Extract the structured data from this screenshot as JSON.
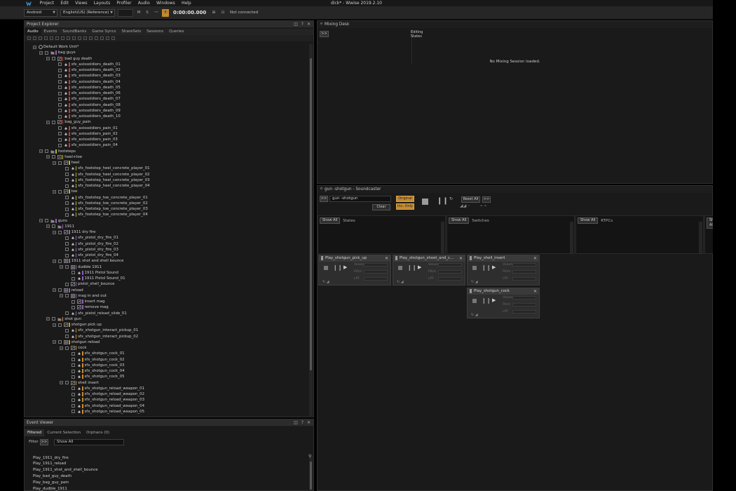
{
  "window": {
    "title": "dick* - Wwise 2019.2.10",
    "menus": [
      "Project",
      "Edit",
      "Views",
      "Layouts",
      "Profiler",
      "Audio",
      "Windows",
      "Help"
    ]
  },
  "toolbar": {
    "platform": "Android",
    "language": "English(US) (Reference)",
    "mute": "M",
    "solo": "S",
    "time": "0:00:00.000",
    "status": "Not connected"
  },
  "project_explorer": {
    "title": "Project Explorer",
    "tabs": [
      "Audio",
      "Events",
      "SoundBanks",
      "Game Syncs",
      "ShareSets",
      "Sessions",
      "Queries"
    ],
    "active_tab": "Audio",
    "tree": [
      {
        "d": 0,
        "t": "wu",
        "label": "Default Work Unit*"
      },
      {
        "d": 1,
        "t": "folder",
        "label": "bag guys",
        "c": "#8f5db7"
      },
      {
        "d": 2,
        "t": "random",
        "label": "bad guy death",
        "c": "#c03a3a"
      },
      {
        "d": 3,
        "t": "sfx",
        "label": "sfx_axissoldiers_death_01",
        "c": "#c03a3a"
      },
      {
        "d": 3,
        "t": "sfx",
        "label": "sfx_axissoldiers_death_02",
        "c": "#c03a3a"
      },
      {
        "d": 3,
        "t": "sfx",
        "label": "sfx_axissoldiers_death_03",
        "c": "#c03a3a"
      },
      {
        "d": 3,
        "t": "sfx",
        "label": "sfx_axissoldiers_death_04",
        "c": "#c03a3a"
      },
      {
        "d": 3,
        "t": "sfx",
        "label": "sfx_axissoldiers_death_05",
        "c": "#c03a3a"
      },
      {
        "d": 3,
        "t": "sfx",
        "label": "sfx_axissoldiers_death_06",
        "c": "#c03a3a"
      },
      {
        "d": 3,
        "t": "sfx",
        "label": "sfx_axissoldiers_death_07",
        "c": "#c03a3a"
      },
      {
        "d": 3,
        "t": "sfx",
        "label": "sfx_axissoldiers_death_08",
        "c": "#c03a3a"
      },
      {
        "d": 3,
        "t": "sfx",
        "label": "sfx_axissoldiers_death_09",
        "c": "#c03a3a"
      },
      {
        "d": 3,
        "t": "sfx",
        "label": "sfx_axissoldiers_death_10",
        "c": "#c03a3a"
      },
      {
        "d": 2,
        "t": "random",
        "label": "bag_guy_pain",
        "c": "#c03a3a"
      },
      {
        "d": 3,
        "t": "sfx",
        "label": "sfx_axissoldiers_pain_01",
        "c": "#c03a3a"
      },
      {
        "d": 3,
        "t": "sfx",
        "label": "sfx_axissoldiers_pain_02",
        "c": "#c03a3a"
      },
      {
        "d": 3,
        "t": "sfx",
        "label": "sfx_axissoldiers_pain_03",
        "c": "#c03a3a"
      },
      {
        "d": 3,
        "t": "sfx",
        "label": "sfx_axissoldiers_pain_04",
        "c": "#c03a3a"
      },
      {
        "d": 1,
        "t": "folder",
        "label": "footsteps",
        "c": "#b8b02f"
      },
      {
        "d": 2,
        "t": "switch",
        "label": "heel+toe",
        "c": "#b8b02f"
      },
      {
        "d": 3,
        "t": "random",
        "label": "heel",
        "c": "#b8b02f"
      },
      {
        "d": 4,
        "t": "sfx",
        "label": "sfx_footstep_heel_concrete_player_01",
        "c": "#b8b02f"
      },
      {
        "d": 4,
        "t": "sfx",
        "label": "sfx_footstep_heel_concrete_player_02",
        "c": "#b8b02f"
      },
      {
        "d": 4,
        "t": "sfx",
        "label": "sfx_footstep_heel_concrete_player_03",
        "c": "#b8b02f"
      },
      {
        "d": 4,
        "t": "sfx",
        "label": "sfx_footstep_heel_concrete_player_04",
        "c": "#b8b02f"
      },
      {
        "d": 3,
        "t": "random",
        "label": "toe",
        "c": "#b8b02f"
      },
      {
        "d": 4,
        "t": "sfx",
        "label": "sfx_footstep_toe_concrete_player_01",
        "c": "#b8b02f"
      },
      {
        "d": 4,
        "t": "sfx",
        "label": "sfx_footstep_toe_concrete_player_02",
        "c": "#b8b02f"
      },
      {
        "d": 4,
        "t": "sfx",
        "label": "sfx_footstep_toe_concrete_player_03",
        "c": "#b8b02f"
      },
      {
        "d": 4,
        "t": "sfx",
        "label": "sfx_footstep_toe_concrete_player_04",
        "c": "#b8b02f"
      },
      {
        "d": 1,
        "t": "folder",
        "label": "guns",
        "c": "#8f5db7"
      },
      {
        "d": 2,
        "t": "folder",
        "label": "1911",
        "c": "#8f5db7"
      },
      {
        "d": 3,
        "t": "random",
        "label": "1911 dry fire",
        "c": "#8f5db7"
      },
      {
        "d": 4,
        "t": "sfx",
        "label": "sfx_pistol_dry_fire_01",
        "c": "#8f5db7"
      },
      {
        "d": 4,
        "t": "sfx",
        "label": "sfx_pistol_dry_fire_02",
        "c": "#8f5db7"
      },
      {
        "d": 4,
        "t": "sfx",
        "label": "sfx_pistol_dry_fire_03",
        "c": "#8f5db7"
      },
      {
        "d": 4,
        "t": "sfx",
        "label": "sfx_pistol_dry_fire_04",
        "c": "#8f5db7"
      },
      {
        "d": 3,
        "t": "seq",
        "label": "1911 shot and shell bounce",
        "c": "#8f5db7"
      },
      {
        "d": 4,
        "t": "seq",
        "label": "dudble 1911",
        "c": "#8f5db7"
      },
      {
        "d": 5,
        "t": "sfx",
        "label": "1911 Pistol Sound",
        "c": "#8f5db7"
      },
      {
        "d": 5,
        "t": "sfx",
        "label": "1911 Pistol Sound_01",
        "c": "#8f5db7"
      },
      {
        "d": 4,
        "t": "random",
        "label": "pistol_shell_bounce",
        "c": "#8f5db7"
      },
      {
        "d": 3,
        "t": "seq",
        "label": "reload",
        "c": "#8f5db7"
      },
      {
        "d": 4,
        "t": "seq",
        "label": "mag in and out",
        "c": "#8f5db7"
      },
      {
        "d": 5,
        "t": "random",
        "label": "insert mag",
        "c": "#8f5db7"
      },
      {
        "d": 5,
        "t": "random",
        "label": "remove mag",
        "c": "#8f5db7"
      },
      {
        "d": 4,
        "t": "sfx",
        "label": "sfx_pistol_reload_slide_01",
        "c": "#8f5db7"
      },
      {
        "d": 2,
        "t": "folder",
        "label": "shot gun",
        "c": "#d08a2e"
      },
      {
        "d": 3,
        "t": "random",
        "label": "shotgun pick up",
        "c": "#d08a2e"
      },
      {
        "d": 4,
        "t": "sfx",
        "label": "sfx_shotgun_interact_pickup_01",
        "c": "#d08a2e"
      },
      {
        "d": 4,
        "t": "sfx",
        "label": "sfx_shotgun_interact_pickup_02",
        "c": "#d08a2e"
      },
      {
        "d": 3,
        "t": "seq",
        "label": "shotgun reload",
        "c": "#d08a2e"
      },
      {
        "d": 4,
        "t": "random",
        "label": "cock",
        "c": "#d08a2e"
      },
      {
        "d": 5,
        "t": "sfx",
        "label": "sfx_shotgun_cock_01",
        "c": "#d08a2e"
      },
      {
        "d": 5,
        "t": "sfx",
        "label": "sfx_shotgun_cock_02",
        "c": "#d08a2e"
      },
      {
        "d": 5,
        "t": "sfx",
        "label": "sfx_shotgun_cock_03",
        "c": "#d08a2e"
      },
      {
        "d": 5,
        "t": "sfx",
        "label": "sfx_shotgun_cock_04",
        "c": "#d08a2e"
      },
      {
        "d": 5,
        "t": "sfx",
        "label": "sfx_shotgun_cock_05",
        "c": "#d08a2e"
      },
      {
        "d": 4,
        "t": "random",
        "label": "shell insert",
        "c": "#d08a2e"
      },
      {
        "d": 5,
        "t": "sfx",
        "label": "sfx_shotgun_reload_weapon_01",
        "c": "#d08a2e"
      },
      {
        "d": 5,
        "t": "sfx",
        "label": "sfx_shotgun_reload_weapon_02",
        "c": "#d08a2e"
      },
      {
        "d": 5,
        "t": "sfx",
        "label": "sfx_shotgun_reload_weapon_03",
        "c": "#d08a2e"
      },
      {
        "d": 5,
        "t": "sfx",
        "label": "sfx_shotgun_reload_weapon_04",
        "c": "#d08a2e"
      },
      {
        "d": 5,
        "t": "sfx",
        "label": "sfx_shotgun_reload_weapon_05",
        "c": "#d08a2e"
      }
    ]
  },
  "event_viewer": {
    "title": "Event Viewer",
    "tabs": [
      "Filtered",
      "Current Selection",
      "Orphans (0)"
    ],
    "filter_label": "Filter",
    "filter_btn": ">>",
    "filter_value": "Show All",
    "events": [
      "Play_1911_dry_fire",
      "Play_1911_reload",
      "Play_1911_shot_and_shell_bounce",
      "Play_bad_guy_death",
      "Play_bag_guy_pain",
      "Play_dudble_1911"
    ]
  },
  "mixing_desk": {
    "title": "Mixing Desk",
    "btn": ">>",
    "editing": "Editing",
    "states": "States",
    "empty": "No Mixing Session loaded."
  },
  "soundcaster": {
    "title": "gun -shotgun - Soundcaster",
    "btn": ">>",
    "name": "gun -shotgun",
    "clear": "Clear",
    "original": "Original",
    "inc_only": "Inc. Only",
    "reset_all": "Reset All",
    "more": ">>",
    "show_all": "Show All",
    "sections": [
      "States",
      "Switches",
      "RTPCs"
    ],
    "params": [
      "Volume",
      "Pitch",
      "LPF"
    ],
    "cards": [
      "Play_shotgun_pick_up",
      "Play_shotgun_shoot_and_c...",
      "Play_shell_insert",
      "Play_shotgun_cock"
    ]
  },
  "colors": {
    "bg": "#1a1a1a",
    "accent": "#c48a2e"
  }
}
